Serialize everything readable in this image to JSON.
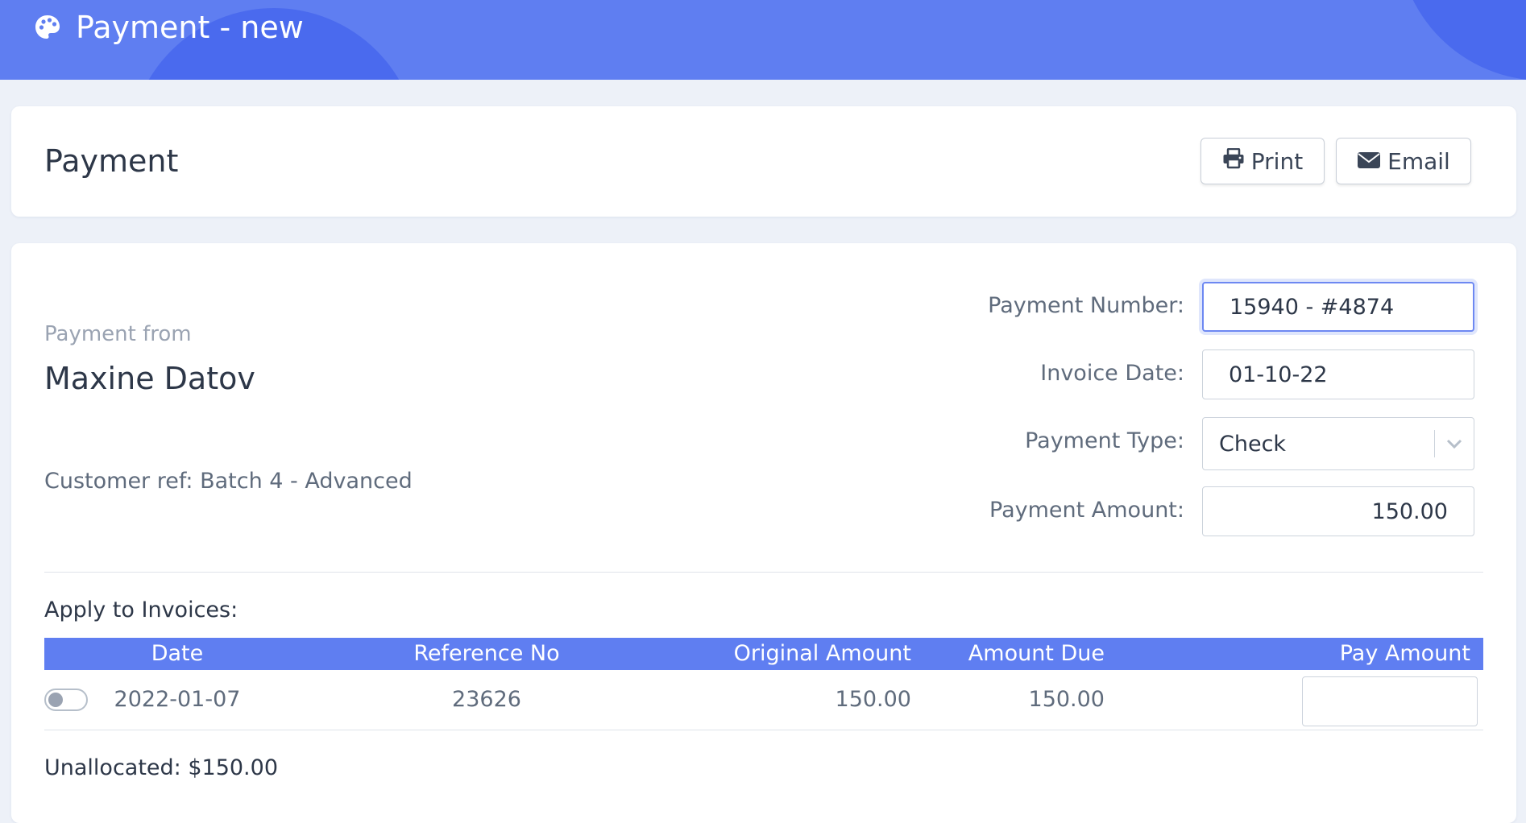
{
  "topbar": {
    "title": "Payment - new",
    "icon": "palette-icon"
  },
  "header": {
    "heading": "Payment",
    "print_label": "Print",
    "email_label": "Email",
    "print_icon": "printer-icon",
    "email_icon": "envelope-icon"
  },
  "customer": {
    "from_label": "Payment from",
    "name": "Maxine Datov",
    "ref": "Customer ref: Batch 4 - Advanced"
  },
  "form": {
    "payment_number_label": "Payment Number:",
    "payment_number_value": "15940 - #4874",
    "invoice_date_label": "Invoice Date:",
    "invoice_date_value": "01-10-22",
    "payment_type_label": "Payment Type:",
    "payment_type_value": "Check",
    "payment_amount_label": "Payment Amount:",
    "payment_amount_value": "150.00"
  },
  "invoices": {
    "title": "Apply to Invoices:",
    "columns": [
      "Date",
      "Reference No",
      "Original Amount",
      "Amount Due",
      "Pay Amount"
    ],
    "rows": [
      {
        "selected": false,
        "date": "2022-01-07",
        "reference": "23626",
        "original_amount": "150.00",
        "amount_due": "150.00",
        "pay_amount": ""
      }
    ]
  },
  "summary": {
    "unallocated": "Unallocated: $150.00"
  },
  "colors": {
    "accent": "#5f7ef1",
    "background": "#edf1f8",
    "text": "#2d3748",
    "muted": "#5f6b7c"
  }
}
